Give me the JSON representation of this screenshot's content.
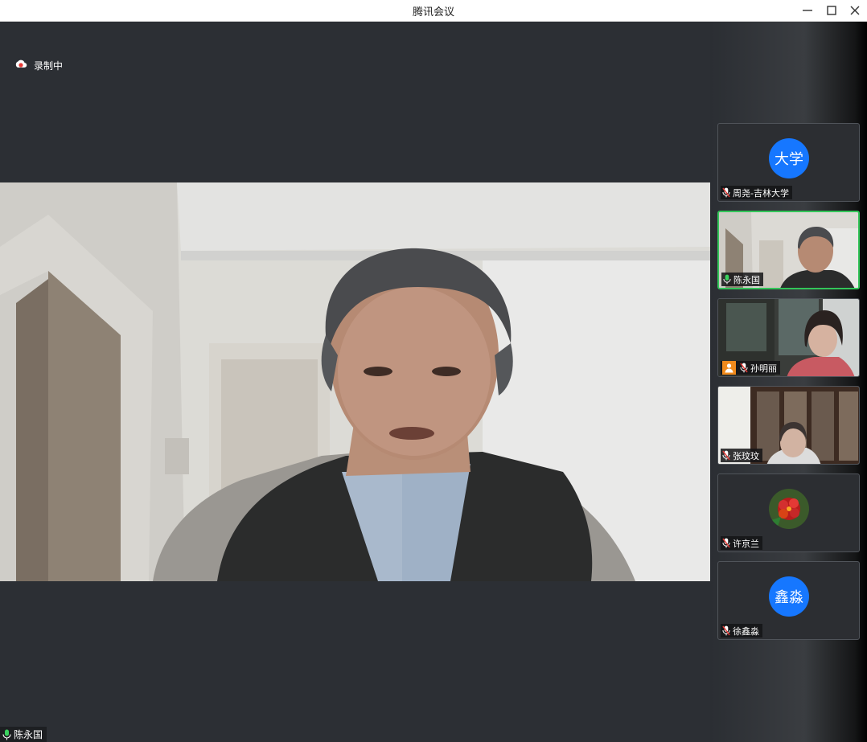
{
  "window": {
    "title": "腾讯会议"
  },
  "recording": {
    "label": "录制中"
  },
  "main_video": {
    "speaker_name": "陈永国"
  },
  "participants": [
    {
      "name": "周尧-吉林大学",
      "avatar_text": "大学",
      "muted": true
    },
    {
      "name": "陈永国",
      "speaking": true
    },
    {
      "name": "孙明丽",
      "muted": true,
      "host": true
    },
    {
      "name": "张玟玟",
      "muted": true
    },
    {
      "name": "许京兰",
      "muted": true
    },
    {
      "name": "徐鑫淼",
      "avatar_text": "鑫淼",
      "muted": true
    }
  ],
  "colors": {
    "avatar_blue": "#1677ff",
    "active_speaker_border": "#33c559",
    "recording_red": "#e53935",
    "muted_red": "#e53935",
    "mic_green": "#3bd35f",
    "host_orange": "#f08a1c"
  }
}
